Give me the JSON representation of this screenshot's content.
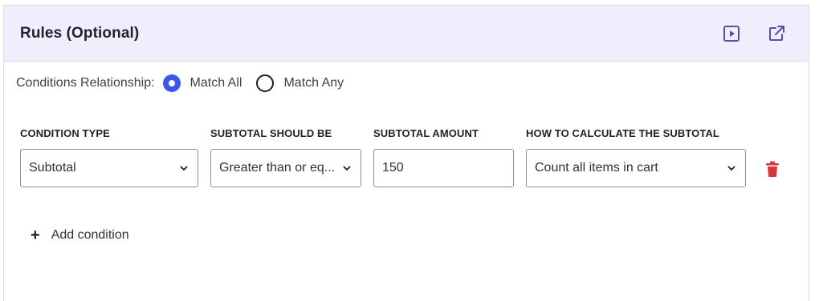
{
  "panel": {
    "title": "Rules (Optional)",
    "icons": {
      "preview": "play-square-icon",
      "open_external": "external-link-icon"
    }
  },
  "relationship": {
    "label": "Conditions Relationship:",
    "options": [
      {
        "label": "Match All",
        "checked": true
      },
      {
        "label": "Match Any",
        "checked": false
      }
    ]
  },
  "condition": {
    "columns": {
      "type": "CONDITION TYPE",
      "operator": "SUBTOTAL SHOULD BE",
      "amount": "SUBTOTAL AMOUNT",
      "calculation": "HOW TO CALCULATE THE SUBTOTAL"
    },
    "values": {
      "type": "Subtotal",
      "operator": "Greater than or eq...",
      "amount": "150",
      "calculation": "Count all items in cart"
    },
    "delete_icon": "trash-icon"
  },
  "add_condition": {
    "label": "Add condition",
    "icon": "plus-icon"
  },
  "colors": {
    "header_bg": "#f0edfd",
    "accent": "#3858e9",
    "icon_purple": "#5b4bb7",
    "delete_red": "#d63638"
  }
}
